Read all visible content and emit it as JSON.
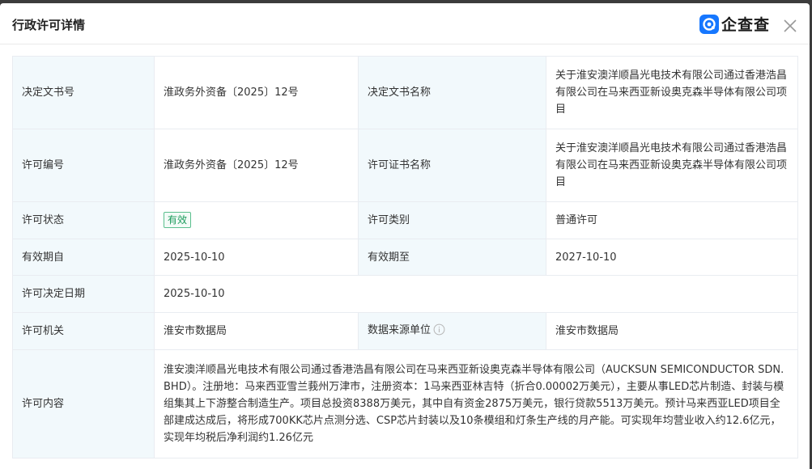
{
  "dialog": {
    "title": "行政许可详情",
    "brand_name": "企查查",
    "colors": {
      "brand": "#1677ff",
      "label_bg": "#f2f9fc",
      "status_green": "#1a9a5b"
    }
  },
  "rows": {
    "decision_no": {
      "label": "决定文书号",
      "value": "淮政务外资备〔2025〕12号"
    },
    "decision_name": {
      "label": "决定文书名称",
      "value": "关于淮安澳洋顺昌光电技术有限公司通过香港浩昌有限公司在马来西亚新设奥克森半导体有限公司项目"
    },
    "license_no": {
      "label": "许可编号",
      "value": "淮政务外资备〔2025〕12号"
    },
    "license_name": {
      "label": "许可证书名称",
      "value": "关于淮安澳洋顺昌光电技术有限公司通过香港浩昌有限公司在马来西亚新设奥克森半导体有限公司项目"
    },
    "status": {
      "label": "许可状态",
      "value": "有效"
    },
    "category": {
      "label": "许可类别",
      "value": "普通许可"
    },
    "valid_from": {
      "label": "有效期自",
      "value": "2025-10-10"
    },
    "valid_to": {
      "label": "有效期至",
      "value": "2027-10-10"
    },
    "decision_date": {
      "label": "许可决定日期",
      "value": "2025-10-10"
    },
    "authority": {
      "label": "许可机关",
      "value": "淮安市数据局"
    },
    "data_source": {
      "label": "数据来源单位",
      "value": "淮安市数据局",
      "icon": "info-icon"
    },
    "content": {
      "label": "许可内容",
      "value": "淮安澳洋顺昌光电技术有限公司通过香港浩昌有限公司在马来西亚新设奥克森半导体有限公司（AUCKSUN SEMICONDUCTOR SDN.BHD）。注册地：马来西亚雪兰莪州万津市，注册资本：1马来西亚林吉特（折合0.00002万美元），主要从事LED芯片制造、封装与模组集其上下游整合制造生产。项目总投资8388万美元，其中自有资金2875万美元，银行贷款5513万美元。预计马来西亚LED项目全部建成达成后，将形成700KK芯片点测分选、CSP芯片封装以及10条模组和灯条生产线的月产能。可实现年均营业收入约12.6亿元，实现年均税后净利润约1.26亿元"
    }
  }
}
